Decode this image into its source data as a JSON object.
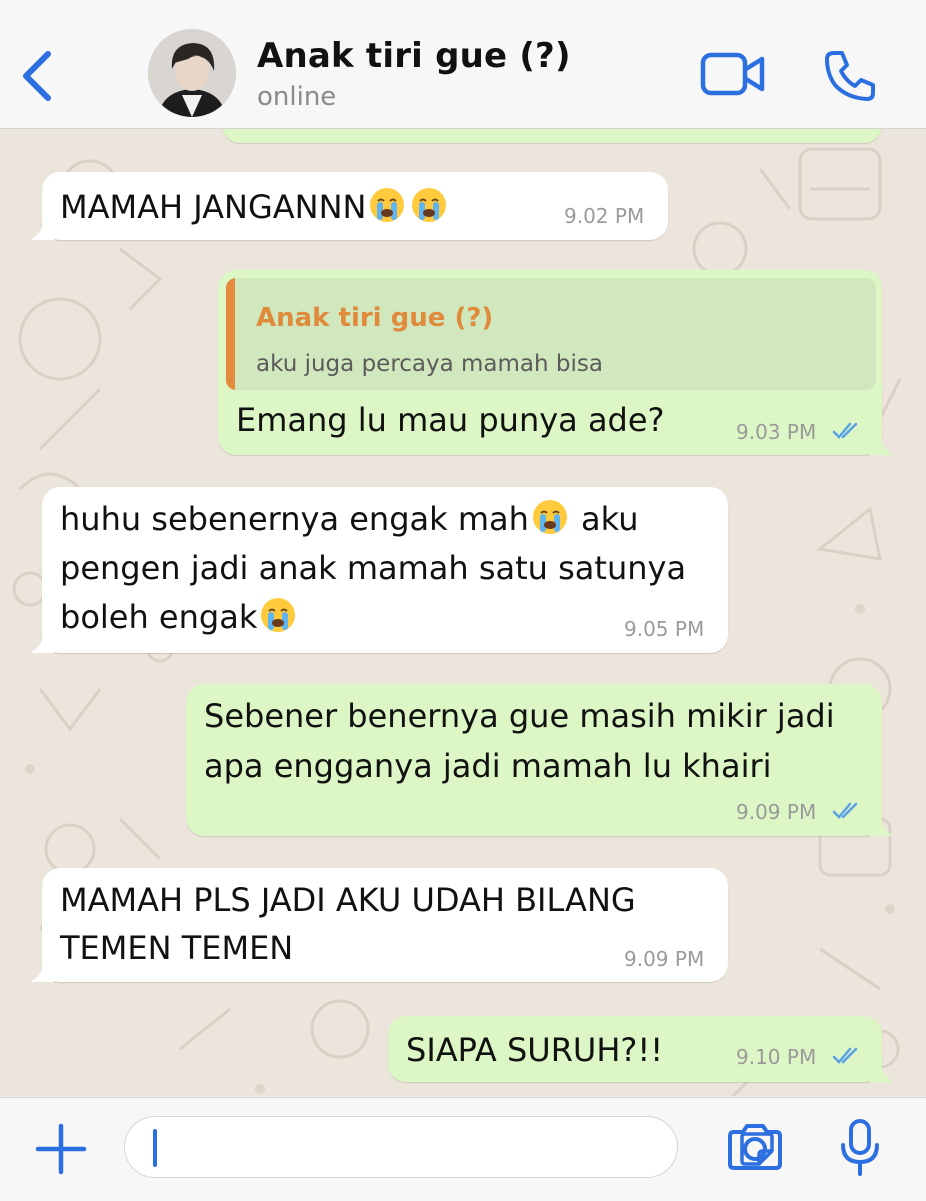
{
  "header": {
    "contact_name": "Anak tiri gue (?)",
    "status": "online",
    "back_icon": "chevron-left-icon",
    "video_icon": "video-camera-icon",
    "call_icon": "phone-icon"
  },
  "messages": [
    {
      "direction": "in",
      "text": "MAMAH JANGANNN",
      "emoji_suffix": [
        "crying-face",
        "crying-face"
      ],
      "time": "9.02 PM"
    },
    {
      "direction": "out",
      "quote": {
        "author": "Anak tiri gue (?)",
        "text": "aku juga percaya mamah bisa"
      },
      "text": "Emang lu mau punya ade?",
      "time": "9.03 PM",
      "status": "read"
    },
    {
      "direction": "in",
      "lines": [
        "huhu sebenernya engak mah",
        " aku",
        "pengen jadi anak mamah satu satunya",
        "boleh engak"
      ],
      "time": "9.05 PM"
    },
    {
      "direction": "out",
      "lines": [
        "Sebener benernya gue masih mikir jadi",
        "apa engganya jadi mamah lu khairi"
      ],
      "time": "9.09 PM",
      "status": "read"
    },
    {
      "direction": "in",
      "lines": [
        "MAMAH PLS JADI AKU UDAH BILANG",
        "TEMEN TEMEN"
      ],
      "time": "9.09 PM"
    },
    {
      "direction": "out",
      "text": "SIAPA SURUH?!!",
      "time": "9.10 PM",
      "status": "read"
    }
  ],
  "input_bar": {
    "placeholder": "",
    "value": "",
    "icons": [
      "plus-icon",
      "sticker-icon",
      "camera-icon",
      "microphone-icon"
    ]
  },
  "colors": {
    "accent": "#2b6fe0",
    "incoming_bubble": "#ffffff",
    "outgoing_bubble": "#dcf7c5",
    "quote_author": "#e08a3c",
    "read_ticks": "#5aa0e6",
    "chat_background": "#ece5dc"
  }
}
